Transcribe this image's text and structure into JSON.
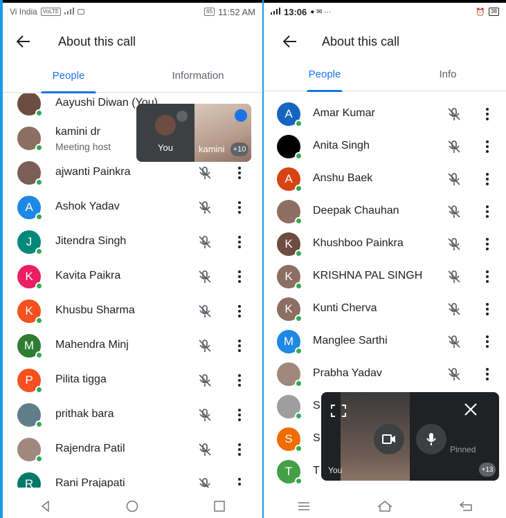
{
  "left": {
    "status": {
      "carrier": "Vi India",
      "volte": "VoLTE",
      "battery": "65",
      "time": "11:52 AM"
    },
    "title": "About this call",
    "tabs": [
      {
        "label": "People",
        "active": true
      },
      {
        "label": "Information",
        "active": false
      }
    ],
    "participants": [
      {
        "name": "Aayushi Diwan (You)",
        "avatar": "photo",
        "color": "#6d4c41"
      },
      {
        "name": "kamini dr",
        "subtitle": "Meeting host",
        "avatar": "photo",
        "color": "#8d6e63"
      },
      {
        "name": "ajwanti Painkra",
        "avatar": "photo",
        "color": "#7b5e57"
      },
      {
        "name": "Ashok Yadav",
        "initial": "A",
        "color": "#1e88e5"
      },
      {
        "name": "Jitendra Singh",
        "initial": "J",
        "color": "#00897b"
      },
      {
        "name": "Kavita Paikra",
        "initial": "K",
        "color": "#e91e63"
      },
      {
        "name": "Khusbu Sharma",
        "initial": "K",
        "color": "#f4511e"
      },
      {
        "name": "Mahendra Minj",
        "initial": "M",
        "color": "#2e7d32"
      },
      {
        "name": "Pilita tigga",
        "initial": "P",
        "color": "#f4511e"
      },
      {
        "name": "prithak bara",
        "avatar": "photo",
        "color": "#607d8b"
      },
      {
        "name": "Rajendra Patil",
        "avatar": "photo",
        "color": "#a1887f"
      },
      {
        "name": "Rani Prajapati",
        "initial": "R",
        "color": "#00796b"
      }
    ],
    "pip": {
      "you_label": "You",
      "kamini_label": "kamini",
      "more_count": "+10"
    }
  },
  "right": {
    "status": {
      "time": "13:06",
      "battery": "38"
    },
    "title": "About this call",
    "tabs": [
      {
        "label": "People",
        "active": true
      },
      {
        "label": "Info",
        "active": false
      }
    ],
    "participants": [
      {
        "name": "Amar Kumar",
        "initial": "A",
        "color": "#1565c0"
      },
      {
        "name": "Anita Singh",
        "initial": "",
        "color": "#000000"
      },
      {
        "name": "Anshu Baek",
        "initial": "A",
        "color": "#d84315"
      },
      {
        "name": "Deepak Chauhan",
        "avatar": "photo",
        "color": "#8d6e63"
      },
      {
        "name": "Khushboo Painkra",
        "initial": "K",
        "color": "#6d4c41"
      },
      {
        "name": "KRISHNA PAL SINGH",
        "initial": "K",
        "color": "#8d6e63"
      },
      {
        "name": "Kunti Cherva",
        "initial": "K",
        "color": "#8d6e63"
      },
      {
        "name": "Manglee Sarthi",
        "initial": "M",
        "color": "#1e88e5"
      },
      {
        "name": "Prabha Yadav",
        "avatar": "photo",
        "color": "#a1887f"
      },
      {
        "name": "S",
        "avatar": "photo",
        "color": "#9e9e9e"
      },
      {
        "name": "S",
        "initial": "S",
        "color": "#ef6c00"
      },
      {
        "name": "T",
        "initial": "T",
        "color": "#43a047"
      }
    ],
    "pip": {
      "you_label": "You",
      "pinned_label": "Pinned",
      "more_count": "+13"
    }
  }
}
